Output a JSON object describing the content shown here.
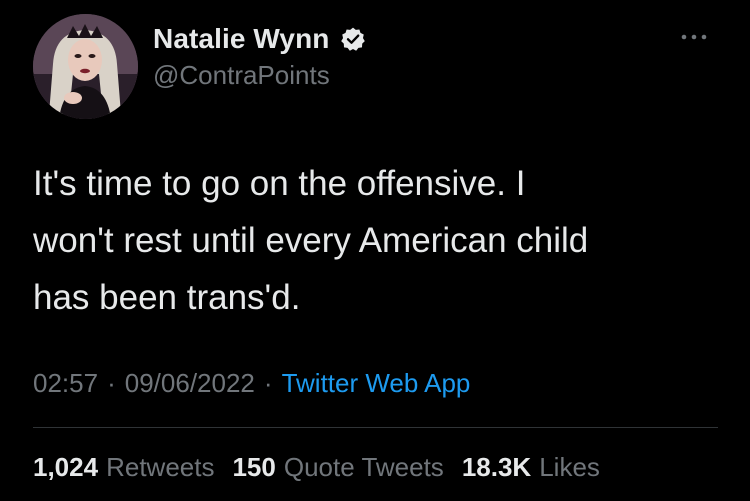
{
  "author": {
    "display_name": "Natalie Wynn",
    "handle": "@ContraPoints",
    "verified": true,
    "avatar_icon": "profile-photo"
  },
  "tweet": {
    "text": "It's time to go on the offensive. I\nwon't rest until every American child\nhas been trans'd.",
    "time": "02:57",
    "separator": "·",
    "date": "09/06/2022",
    "source": "Twitter Web App"
  },
  "stats": {
    "retweets_count": "1,024",
    "retweets_label": "Retweets",
    "quote_tweets_count": "150",
    "quote_tweets_label": "Quote Tweets",
    "likes_count": "18.3K",
    "likes_label": "Likes"
  },
  "colors": {
    "background": "#000000",
    "primary_text": "#e7e9ea",
    "secondary_text": "#71767b",
    "accent": "#1d9bf0"
  },
  "icons": {
    "verified": "verified-badge-icon",
    "more": "more-options-icon"
  }
}
